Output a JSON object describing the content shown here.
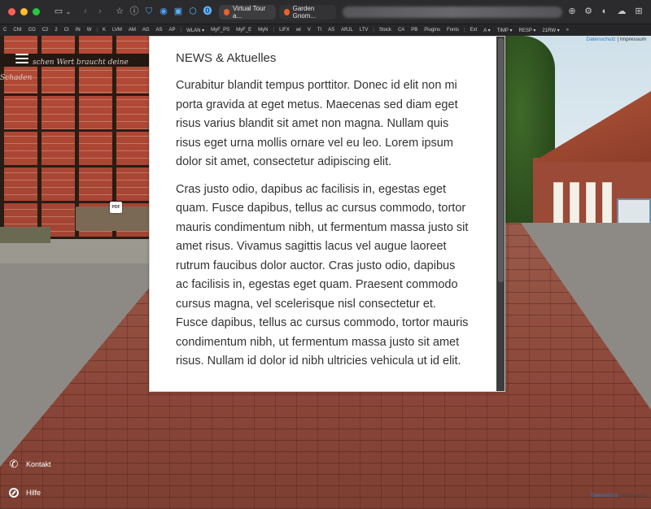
{
  "browser": {
    "tabs": [
      {
        "label": "Virtual Tour a..."
      },
      {
        "label": "Garden Gnom..."
      }
    ],
    "bookmarks": [
      "C",
      "CNI",
      "CO",
      "C2",
      "2",
      "CI",
      "IN",
      "W",
      "|",
      "K",
      "LVM",
      "AM",
      "AG",
      "AS",
      "AP",
      "|",
      "WLAN ▾",
      "MyF_PS",
      "MyF_E",
      "MyN",
      "|",
      "LIFX",
      "wt",
      "V",
      "TI",
      "AS",
      "ARJL",
      "LTV",
      "|",
      "Stock",
      "CA",
      "PB",
      "Plugins",
      "Fonts",
      "|",
      "Ext",
      "A ▾",
      "TIMP ▾",
      "RESP ▾",
      "21RW ▾",
      "»"
    ]
  },
  "scene": {
    "wall_text": "schen Wert braucht deine Schaden"
  },
  "top_links": {
    "datenschutz": "Datenschutz",
    "separator": "|",
    "impressum": "Impressum"
  },
  "bottom_links": {
    "datenschutz": "Datenschutz",
    "separator": "|",
    "impressum": "Impressum"
  },
  "pdf_label": "PDF",
  "news": {
    "title": "NEWS & Aktuelles",
    "paragraphs": [
      "Curabitur blandit tempus porttitor. Donec id elit non mi porta gravida at eget metus. Maecenas sed diam eget risus varius blandit sit amet non magna. Nullam quis risus eget urna mollis ornare vel eu leo. Lorem ipsum dolor sit amet, consectetur adipiscing elit.",
      "Cras justo odio, dapibus ac facilisis in, egestas eget quam. Fusce dapibus, tellus ac cursus commodo, tortor mauris condimentum nibh, ut fermentum massa justo sit amet risus. Vivamus sagittis lacus vel augue laoreet rutrum faucibus dolor auctor. Cras justo odio, dapibus ac facilisis in, egestas eget quam. Praesent commodo cursus magna, vel scelerisque nisl consectetur et. Fusce dapibus, tellus ac cursus commodo, tortor mauris condimentum nibh, ut fermentum massa justo sit amet risus. Nullam id dolor id nibh ultricies vehicula ut id elit."
    ]
  },
  "side_buttons": {
    "kontakt": "Kontakt",
    "hilfe": "Hilfe"
  },
  "icons": {
    "phone": "phone-icon",
    "help": "compass-icon",
    "menu": "hamburger-menu-icon"
  },
  "colors": {
    "link": "#2a7fc2",
    "traffic_red": "#ff5f57",
    "traffic_yellow": "#febc2e",
    "traffic_green": "#28c840"
  }
}
